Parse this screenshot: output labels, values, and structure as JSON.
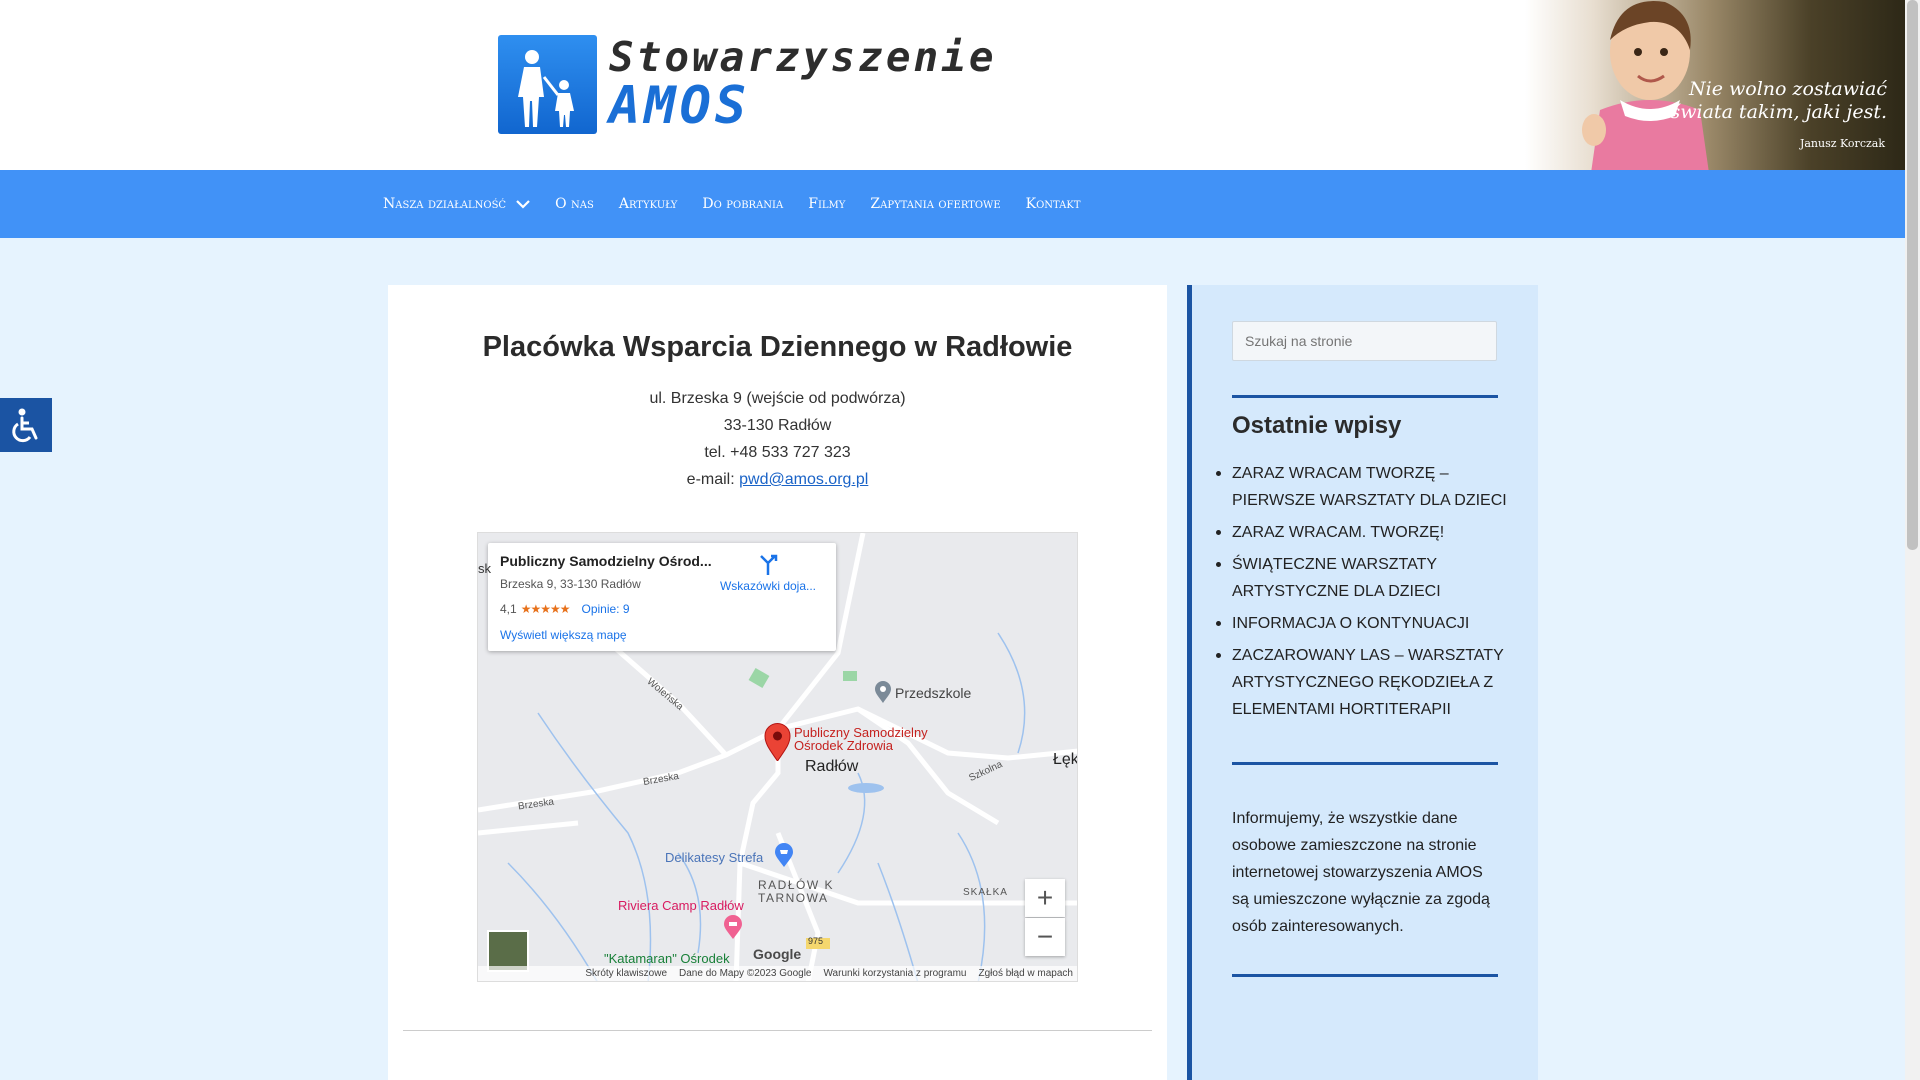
{
  "brand": {
    "line1": "Stowarzyszenie",
    "line2": "AMOS"
  },
  "banner": {
    "quote_line1": "Nie wolno zostawiać",
    "quote_line2": "świata takim, jaki jest.",
    "author": "Janusz Korczak"
  },
  "nav": {
    "items": [
      {
        "label": "Nasza działalność"
      },
      {
        "label": "O nas"
      },
      {
        "label": "Artykuły"
      },
      {
        "label": "Do pobrania"
      },
      {
        "label": "Filmy"
      },
      {
        "label": "Zapytania ofertowe"
      },
      {
        "label": "Kontakt"
      }
    ]
  },
  "main": {
    "title": "Placówka Wsparcia Dziennego w Radłowie",
    "address_line1": "ul. Brzeska 9 (wejście od podwórza)",
    "address_line2": "33-130 Radłów",
    "phone": "tel. +48 533 727 323",
    "email_label": "e-mail:",
    "email": "pwd@amos.org.pl"
  },
  "map": {
    "place_name": "Publiczny Samodzielny Ośrod...",
    "place_address": "Brzeska 9, 33-130 Radłów",
    "rating": "4,1",
    "stars": "★★★★★",
    "reviews": "Opinie: 9",
    "larger_map": "Wyświetl większą mapę",
    "directions": "Wskazówki doja...",
    "labels": {
      "przedszkole": "Przedszkole",
      "marker_line1": "Publiczny Samodzielny",
      "marker_line2": "Ośrodek Zdrowia",
      "town": "Radłów",
      "lek": "Łęk",
      "delikatesy": "Delikatesy Strefa",
      "radlow_k1": "RADŁÓW K",
      "radlow_k2": "TARNOWA",
      "riviera": "Riviera Camp Radłów",
      "katamaran": "\"Katamaran\" Ośrodek",
      "skalka": "SKAŁKA",
      "brzeska": "Brzeska",
      "brzeska2": "Brzeska",
      "wolenska": "Woleńska",
      "szkolna": "Szkolna",
      "road": "975",
      "sk": "sk",
      "google": "Google"
    },
    "zoom_in": "+",
    "zoom_out": "−",
    "footer": {
      "shortcuts": "Skróty klawiszowe",
      "data": "Dane do Mapy ©2023 Google",
      "terms": "Warunki korzystania z programu",
      "report": "Zgłoś błąd w mapach"
    }
  },
  "sidebar": {
    "search_placeholder": "Szukaj na stronie",
    "recent_title": "Ostatnie wpisy",
    "recent": [
      "ZARAZ WRACAM TWORZĘ – PIERWSZE WARSZTATY DLA DZIECI",
      "ZARAZ WRACAM. TWORZĘ!",
      "ŚWIĄTECZNE WARSZTATY ARTYSTYCZNE DLA DZIECI",
      "INFORMACJA O KONTYNUACJI",
      "ZACZAROWANY LAS – WARSZTATY ARTYSTYCZNEGO RĘKODZIEŁA Z ELEMENTAMI HORTITERAPII"
    ],
    "info": "Informujemy, że wszystkie dane osobowe zamieszczone na stronie internetowej stowarzyszenia AMOS są umieszczone wyłącznie za zgodą osób zainteresowanych."
  },
  "colors": {
    "nav": "#4192f7",
    "accent": "#1b54a3",
    "page_bg": "#e6f3fe",
    "sidebar_bg": "#d5e9fc"
  }
}
